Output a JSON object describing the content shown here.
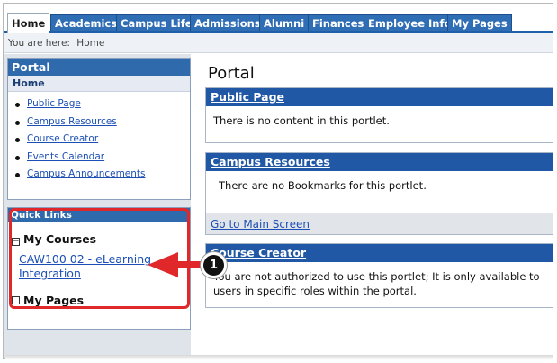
{
  "tabs": [
    "Home",
    "Academics",
    "Campus Life",
    "Admissions",
    "Alumni",
    "Finances",
    "Employee Info",
    "My Pages"
  ],
  "breadcrumb": {
    "prefix": "You are here:",
    "current": "Home"
  },
  "sidebar": {
    "portal_title": "Portal",
    "home_label": "Home",
    "links": [
      "Public Page",
      "Campus Resources",
      "Course Creator",
      "Events Calendar",
      "Campus Announcements"
    ],
    "quick_links_title": "Quick Links",
    "my_courses_label": "My Courses",
    "course_link": "CAW100 02 - eLearning Integration",
    "my_pages_label": "My Pages"
  },
  "main": {
    "page_title": "Portal",
    "portlets": [
      {
        "title": "Public Page",
        "body": "There is no content in this portlet."
      },
      {
        "title": "Campus Resources",
        "body": "There are no Bookmarks for this portlet.",
        "footer_link": "Go to Main Screen"
      },
      {
        "title": "Course Creator",
        "body": "You are not authorized to use this portlet; It is only available to users in specific roles within the portal."
      }
    ]
  },
  "callout": {
    "number": "1"
  },
  "colors": {
    "tab_blue": "#2f6eb5",
    "header_blue": "#2158a6",
    "highlight_red": "#e0282a",
    "link_blue": "#1b4fb5"
  }
}
